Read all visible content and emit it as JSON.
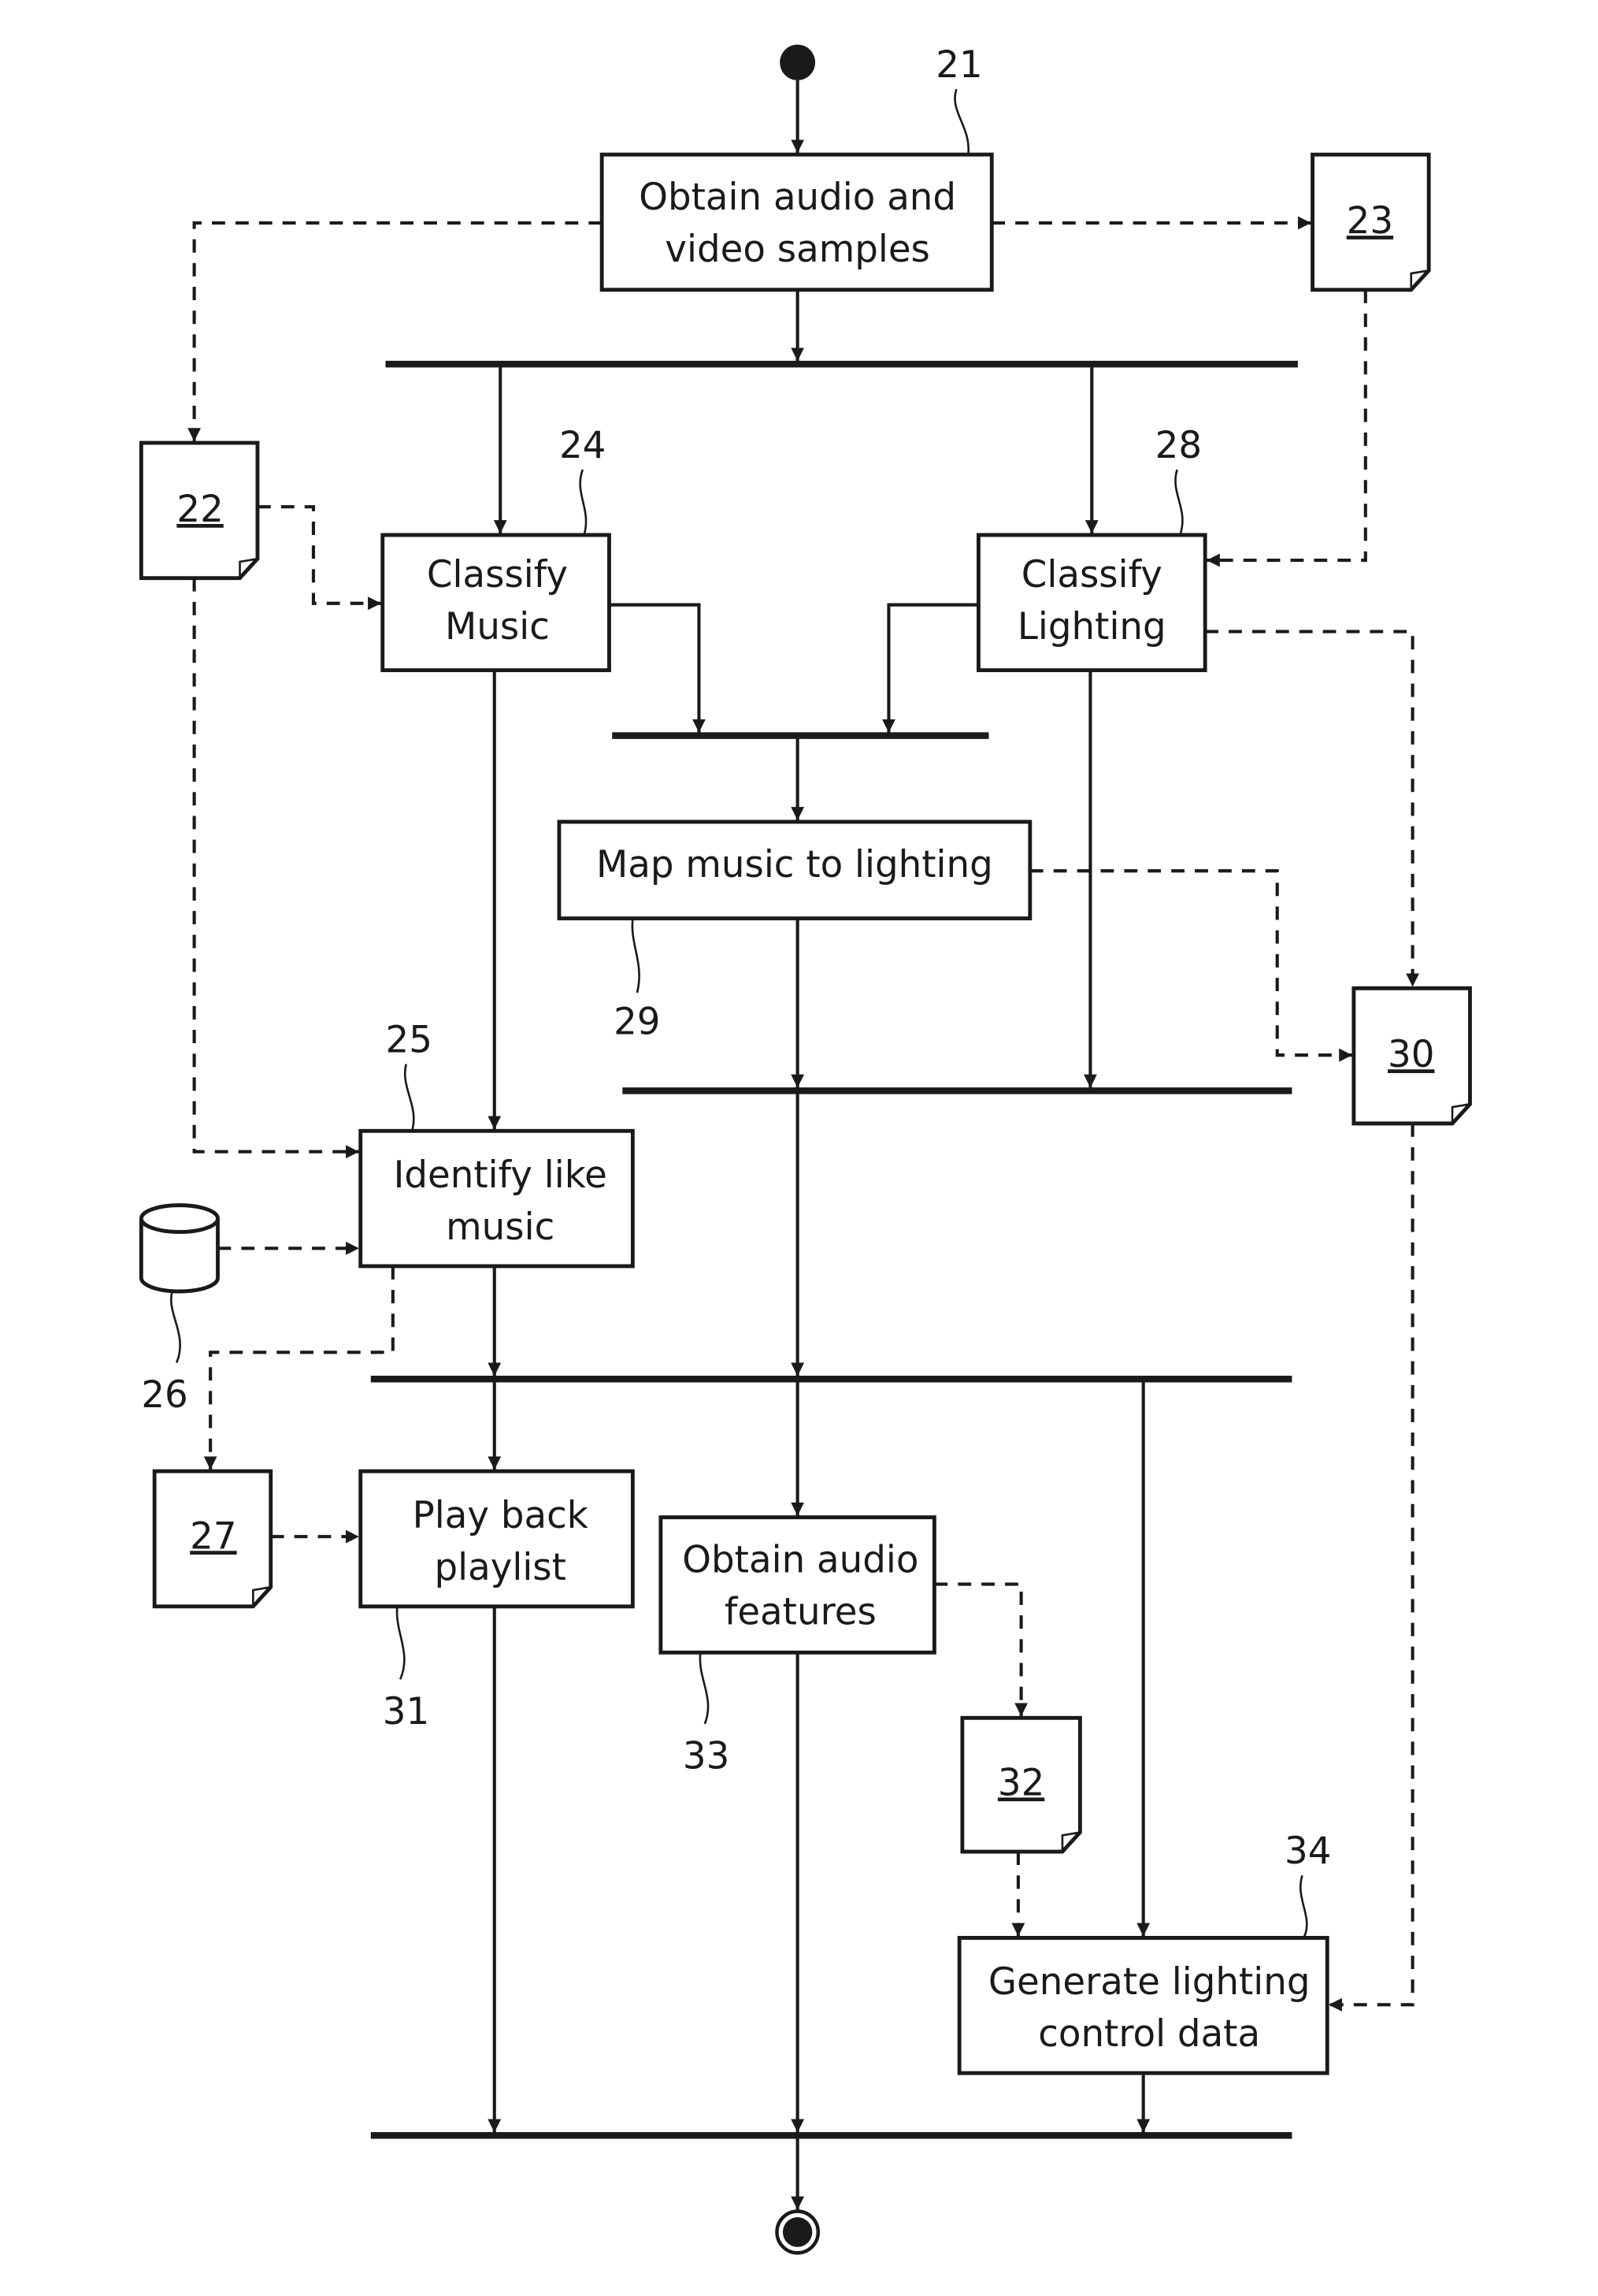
{
  "diagram": {
    "type": "activity-flowchart",
    "colors": {
      "ink": "#1a1a1a",
      "background": "#ffffff"
    },
    "nodes": {
      "start": {
        "kind": "initial-node"
      },
      "end": {
        "kind": "final-node"
      },
      "n21": {
        "ref": "21",
        "kind": "action",
        "lines": [
          "Obtain audio and",
          "video samples"
        ]
      },
      "n24": {
        "ref": "24",
        "kind": "action",
        "lines": [
          "Classify",
          "Music"
        ]
      },
      "n28": {
        "ref": "28",
        "kind": "action",
        "lines": [
          "Classify",
          "Lighting"
        ]
      },
      "n29": {
        "ref": "29",
        "kind": "action",
        "lines": [
          "Map music to lighting"
        ]
      },
      "n25": {
        "ref": "25",
        "kind": "action",
        "lines": [
          "Identify like",
          "music"
        ]
      },
      "n31": {
        "ref": "31",
        "kind": "action",
        "lines": [
          "Play back",
          "playlist"
        ]
      },
      "n33": {
        "ref": "33",
        "kind": "action",
        "lines": [
          "Obtain audio",
          "features"
        ]
      },
      "n34": {
        "ref": "34",
        "kind": "action",
        "lines": [
          "Generate lighting",
          "control data"
        ]
      },
      "d22": {
        "ref": "22",
        "kind": "document"
      },
      "d23": {
        "ref": "23",
        "kind": "document"
      },
      "d27": {
        "ref": "27",
        "kind": "document"
      },
      "d30": {
        "ref": "30",
        "kind": "document"
      },
      "d32": {
        "ref": "32",
        "kind": "document"
      },
      "db26": {
        "ref": "26",
        "kind": "database"
      }
    },
    "edges": [
      {
        "from": "start",
        "to": "n21",
        "style": "solid"
      },
      {
        "from": "n21",
        "to": "fork1",
        "style": "solid"
      },
      {
        "from": "fork1",
        "to": "n24",
        "style": "solid"
      },
      {
        "from": "fork1",
        "to": "n28",
        "style": "solid"
      },
      {
        "from": "n21",
        "to": "d22",
        "style": "dashed"
      },
      {
        "from": "n21",
        "to": "d23",
        "style": "dashed"
      },
      {
        "from": "d22",
        "to": "n24",
        "style": "dashed"
      },
      {
        "from": "d23",
        "to": "n28",
        "style": "dashed"
      },
      {
        "from": "n24",
        "to": "join2",
        "style": "solid"
      },
      {
        "from": "n28",
        "to": "join2",
        "style": "solid"
      },
      {
        "from": "join2",
        "to": "n29",
        "style": "solid"
      },
      {
        "from": "n28",
        "to": "d30",
        "style": "dashed"
      },
      {
        "from": "n29",
        "to": "d30",
        "style": "dashed"
      },
      {
        "from": "n29",
        "to": "join3",
        "style": "solid"
      },
      {
        "from": "n28",
        "to": "join3",
        "style": "solid"
      },
      {
        "from": "n24",
        "to": "n25",
        "style": "solid"
      },
      {
        "from": "d22",
        "to": "n25",
        "style": "dashed"
      },
      {
        "from": "db26",
        "to": "n25",
        "style": "dashed"
      },
      {
        "from": "n25",
        "to": "d27",
        "style": "dashed"
      },
      {
        "from": "n25",
        "to": "fork4",
        "style": "solid"
      },
      {
        "from": "join3",
        "to": "fork4",
        "style": "solid"
      },
      {
        "from": "fork4",
        "to": "n31",
        "style": "solid"
      },
      {
        "from": "fork4",
        "to": "n33",
        "style": "solid"
      },
      {
        "from": "fork4",
        "to": "n34",
        "style": "solid"
      },
      {
        "from": "d27",
        "to": "n31",
        "style": "dashed"
      },
      {
        "from": "n33",
        "to": "d32",
        "style": "dashed"
      },
      {
        "from": "d32",
        "to": "n34",
        "style": "dashed"
      },
      {
        "from": "d30",
        "to": "n34",
        "style": "dashed"
      },
      {
        "from": "n31",
        "to": "join5",
        "style": "solid"
      },
      {
        "from": "n33",
        "to": "join5",
        "style": "solid"
      },
      {
        "from": "n34",
        "to": "join5",
        "style": "solid"
      },
      {
        "from": "join5",
        "to": "end",
        "style": "solid"
      }
    ]
  }
}
